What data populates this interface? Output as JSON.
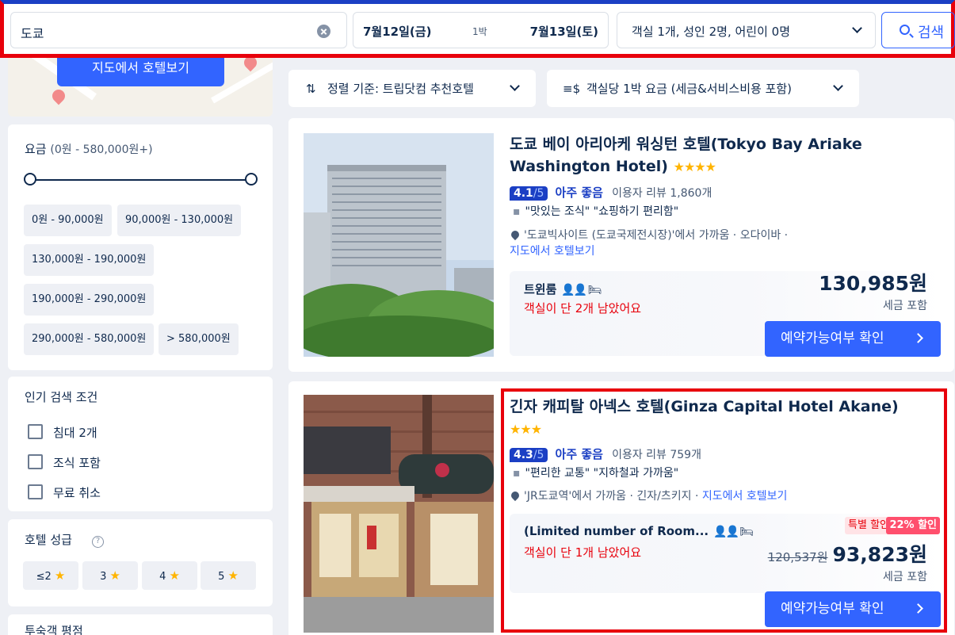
{
  "search": {
    "destination": "도쿄",
    "checkin": "7월12일(금)",
    "nights": "1박",
    "checkout": "7월13일(토)",
    "rooms_guests": "객실 1개, 성인 2명, 어린이 0명",
    "search_label": "검색"
  },
  "map": {
    "button": "지도에서 호텔보기"
  },
  "filters": {
    "price": {
      "title": "요금",
      "range": "(0원 - 580,000원+)",
      "chips": [
        "0원 - 90,000원",
        "90,000원 - 130,000원",
        "130,000원 - 190,000원",
        "190,000원 - 290,000원",
        "290,000원 - 580,000원",
        "> 580,000원"
      ]
    },
    "popular": {
      "title": "인기 검색 조건",
      "options": [
        "침대 2개",
        "조식 포함",
        "무료 취소"
      ]
    },
    "stars": {
      "title": "호텔 성급",
      "help": "?",
      "chips": [
        "≤2",
        "3",
        "4",
        "5"
      ]
    },
    "guest_rating": {
      "title": "투숙객 평점"
    }
  },
  "sort": {
    "sort_label": "정렬 기준: 트립닷컴 추천호텔",
    "price_label": "객실당 1박 요금 (세금&서비스비용 포함)"
  },
  "hotels": [
    {
      "name": "도쿄 베이 아리아케 워싱턴 호텔(Tokyo Bay Ariake Washington Hotel)",
      "stars": "★★★★",
      "score": "4.1",
      "score_out": "/5",
      "rating_text": "아주 좋음",
      "reviews": "이용자 리뷰 1,860개",
      "quotes": "\"맛있는 조식\"  \"쇼핑하기 편리함\"",
      "location": "'도쿄빅사이트 (도쿄국제전시장)'에서 가까움 · 오다이바 ·",
      "map_link": "지도에서 호텔보기",
      "room": "트윈룸",
      "rooms_left": "객실이 단 2개 남았어요",
      "price": "130,985원",
      "tax": "세금 포함",
      "book": "예약가능여부 확인"
    },
    {
      "name": "긴자 캐피탈 아넥스 호텔(Ginza Capital Hotel Akane)",
      "stars": "★★★",
      "score": "4.3",
      "score_out": "/5",
      "rating_text": "아주 좋음",
      "reviews": "이용자 리뷰 759개",
      "quotes": "\"편리한 교통\"  \"지하철과 가까움\"",
      "location": "'JR도쿄역'에서 가까움 · 긴자/츠키지 ·",
      "map_link": "지도에서 호텔보기",
      "room": "(Limited number of Room...",
      "rooms_left": "객실이 단 1개 남았어요",
      "tag_special": "특별 할인",
      "tag_discount": "22% 할인",
      "original_price": "120,537원",
      "price": "93,823원",
      "tax": "세금 포함",
      "book": "예약가능여부 확인"
    }
  ],
  "colors": {
    "brand": "#3264ff",
    "rating": "#1b3fc4",
    "alert": "#e8000b",
    "star": "#ffb400"
  }
}
